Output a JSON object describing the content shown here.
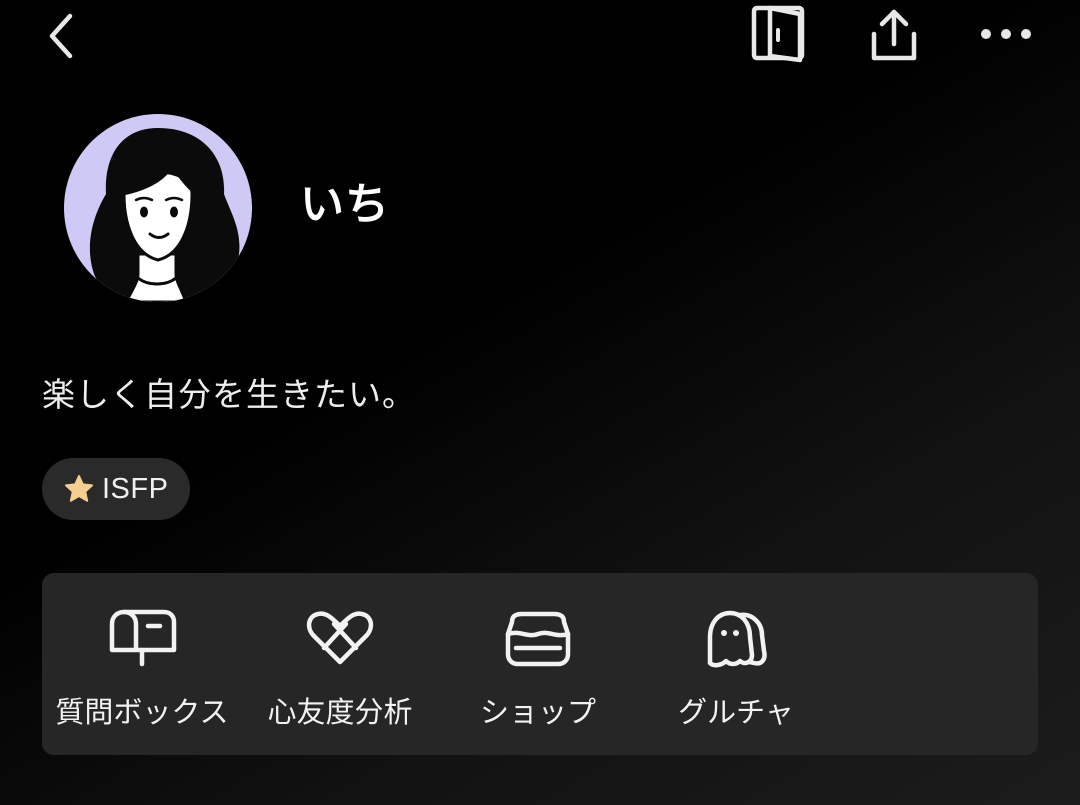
{
  "header": {
    "back_icon": "chevron-left-icon",
    "door_icon": "door-icon",
    "share_icon": "share-upload-icon",
    "more_icon": "more-horizontal-icon"
  },
  "profile": {
    "avatar_bg": "#cfc9f5",
    "name": "いち",
    "bio": "楽しく自分を生きたい。",
    "tag": {
      "icon": "star-icon",
      "label": "ISFP"
    }
  },
  "menu": {
    "items": [
      {
        "label": "質問ボックス",
        "icon": "mailbox-icon"
      },
      {
        "label": "心友度分析",
        "icon": "hearts-icon"
      },
      {
        "label": "ショップ",
        "icon": "lunchbox-icon"
      },
      {
        "label": "グルチャ",
        "icon": "ghosts-icon"
      }
    ]
  },
  "colors": {
    "background": "#000000",
    "card": "#262626",
    "tag_bg": "#2a2a2a",
    "star": "#f5cf8f"
  }
}
